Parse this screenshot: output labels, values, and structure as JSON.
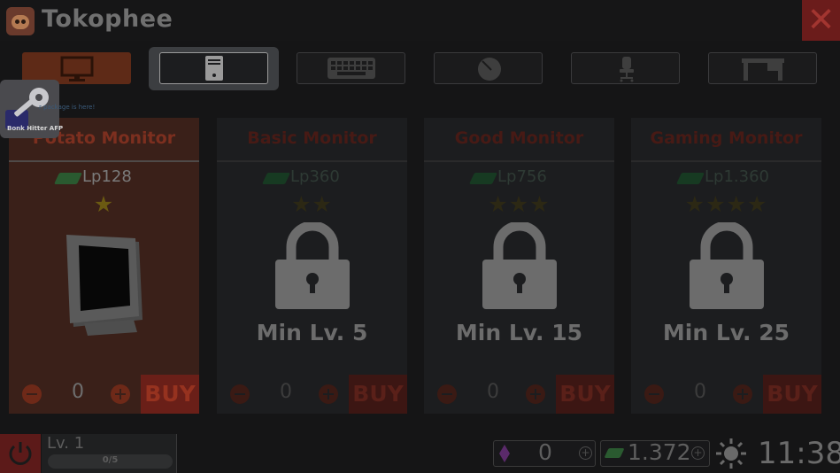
{
  "app": {
    "title": "Tokophee",
    "close_symbol": "✕"
  },
  "tabs": [
    {
      "name": "monitor",
      "icon": "monitor-icon",
      "state": "active"
    },
    {
      "name": "pc-case",
      "icon": "pc-case-icon",
      "state": "selected"
    },
    {
      "name": "keyboard",
      "icon": "keyboard-icon",
      "state": "normal"
    },
    {
      "name": "mouse",
      "icon": "mouse-icon",
      "state": "normal"
    },
    {
      "name": "chair",
      "icon": "chair-icon",
      "state": "normal"
    },
    {
      "name": "desk",
      "icon": "desk-icon",
      "state": "normal"
    }
  ],
  "notification": {
    "text": "r package is here!",
    "caption": "Bonk Hitter AFP",
    "icon": "key-icon"
  },
  "cards": [
    {
      "name": "Potato Monitor",
      "price": "Lp128",
      "stars": "★",
      "locked": false,
      "min_level": "",
      "quantity": "0",
      "buy_label": "BUY"
    },
    {
      "name": "Basic Monitor",
      "price": "Lp360",
      "stars": "★★",
      "locked": true,
      "min_level": "Min Lv. 5",
      "quantity": "0",
      "buy_label": "BUY"
    },
    {
      "name": "Good Monitor",
      "price": "Lp756",
      "stars": "★★★",
      "locked": true,
      "min_level": "Min Lv. 15",
      "quantity": "0",
      "buy_label": "BUY"
    },
    {
      "name": "Gaming Monitor",
      "price": "Lp1.360",
      "stars": "★★★★",
      "locked": true,
      "min_level": "Min Lv. 25",
      "quantity": "0",
      "buy_label": "BUY"
    }
  ],
  "status": {
    "level": "Lv. 1",
    "xp": "0/5",
    "xp_progress": 0,
    "gems": "0",
    "money": "1.372",
    "time": "11:38",
    "weather_icon": "sun-icon"
  },
  "colors": {
    "accent": "#5e2a17",
    "close": "#6b1c1b",
    "buy": "#6a1f18",
    "star": "#6b5a12"
  }
}
